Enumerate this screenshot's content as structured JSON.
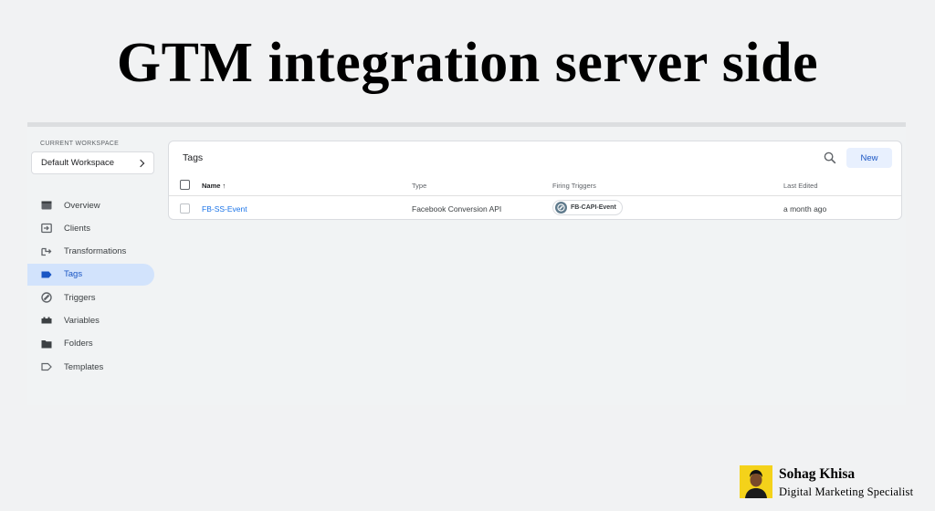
{
  "headline": "GTM integration server side",
  "sidebar": {
    "workspace_label": "CURRENT WORKSPACE",
    "workspace_value": "Default Workspace",
    "items": [
      {
        "label": "Overview",
        "icon": "overview-icon"
      },
      {
        "label": "Clients",
        "icon": "clients-icon"
      },
      {
        "label": "Transformations",
        "icon": "transformations-icon"
      },
      {
        "label": "Tags",
        "icon": "tag-icon",
        "active": true
      },
      {
        "label": "Triggers",
        "icon": "triggers-icon"
      },
      {
        "label": "Variables",
        "icon": "variables-icon"
      },
      {
        "label": "Folders",
        "icon": "folder-icon"
      },
      {
        "label": "Templates",
        "icon": "templates-icon"
      }
    ]
  },
  "tags_panel": {
    "title": "Tags",
    "new_label": "New",
    "columns": {
      "name": "Name ↑",
      "type": "Type",
      "triggers": "Firing Triggers",
      "edited": "Last Edited"
    },
    "rows": [
      {
        "name": "FB-SS-Event",
        "type": "Facebook Conversion API",
        "trigger": "FB-CAPI-Event",
        "edited": "a month ago"
      }
    ]
  },
  "author": {
    "name": "Sohag Khisa",
    "role": "Digital Marketing Specialist"
  },
  "colors": {
    "accent": "#1a73e8",
    "active_nav_bg": "#d2e3fc",
    "new_button_bg": "#e8f0fe",
    "avatar_bg": "#f4d21a"
  }
}
